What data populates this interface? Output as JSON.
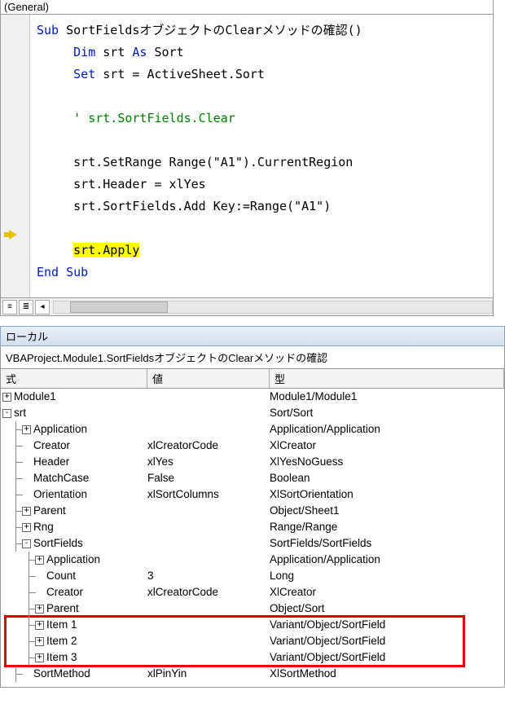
{
  "dropdown": "(General)",
  "code": {
    "l1a": "Sub",
    "l1b": " SortFieldsオブジェクトのClearメソッドの確認()",
    "l2a": "Dim",
    "l2b": " srt ",
    "l2c": "As",
    "l2d": " Sort",
    "l3a": "Set",
    "l3b": " srt = ActiveSheet.Sort",
    "l4": "' srt.SortFields.Clear",
    "l5": "srt.SetRange Range(\"A1\").CurrentRegion",
    "l6": "srt.Header = xlYes",
    "l7": "srt.SortFields.Add Key:=Range(\"A1\")",
    "l8": "srt.Apply",
    "l9": "End Sub"
  },
  "locals_title": "ローカル",
  "context": "VBAProject.Module1.SortFieldsオブジェクトのClearメソッドの確認",
  "headers": {
    "exp": "式",
    "val": "値",
    "type": "型"
  },
  "rows": [
    {
      "indent": 0,
      "icon": "+",
      "name": "Module1",
      "val": "",
      "type": "Module1/Module1"
    },
    {
      "indent": 0,
      "icon": "-",
      "name": "srt",
      "val": "",
      "type": "Sort/Sort"
    },
    {
      "indent": 1,
      "icon": "+",
      "name": "Application",
      "val": "",
      "type": "Application/Application"
    },
    {
      "indent": 1,
      "icon": "",
      "name": "Creator",
      "val": "xlCreatorCode",
      "type": "XlCreator"
    },
    {
      "indent": 1,
      "icon": "",
      "name": "Header",
      "val": "xlYes",
      "type": "XlYesNoGuess"
    },
    {
      "indent": 1,
      "icon": "",
      "name": "MatchCase",
      "val": "False",
      "type": "Boolean"
    },
    {
      "indent": 1,
      "icon": "",
      "name": "Orientation",
      "val": "xlSortColumns",
      "type": "XlSortOrientation"
    },
    {
      "indent": 1,
      "icon": "+",
      "name": "Parent",
      "val": "",
      "type": "Object/Sheet1"
    },
    {
      "indent": 1,
      "icon": "+",
      "name": "Rng",
      "val": "",
      "type": "Range/Range"
    },
    {
      "indent": 1,
      "icon": "-",
      "name": "SortFields",
      "val": "",
      "type": "SortFields/SortFields"
    },
    {
      "indent": 2,
      "icon": "+",
      "name": "Application",
      "val": "",
      "type": "Application/Application"
    },
    {
      "indent": 2,
      "icon": "",
      "name": "Count",
      "val": "3",
      "type": "Long"
    },
    {
      "indent": 2,
      "icon": "",
      "name": "Creator",
      "val": "xlCreatorCode",
      "type": "XlCreator"
    },
    {
      "indent": 2,
      "icon": "+",
      "name": "Parent",
      "val": "",
      "type": "Object/Sort"
    },
    {
      "indent": 2,
      "icon": "+",
      "name": "Item 1",
      "val": "",
      "type": "Variant/Object/SortField"
    },
    {
      "indent": 2,
      "icon": "+",
      "name": "Item 2",
      "val": "",
      "type": "Variant/Object/SortField"
    },
    {
      "indent": 2,
      "icon": "+",
      "name": "Item 3",
      "val": "",
      "type": "Variant/Object/SortField"
    },
    {
      "indent": 1,
      "icon": "",
      "name": "SortMethod",
      "val": "xlPinYin",
      "type": "XlSortMethod"
    }
  ]
}
